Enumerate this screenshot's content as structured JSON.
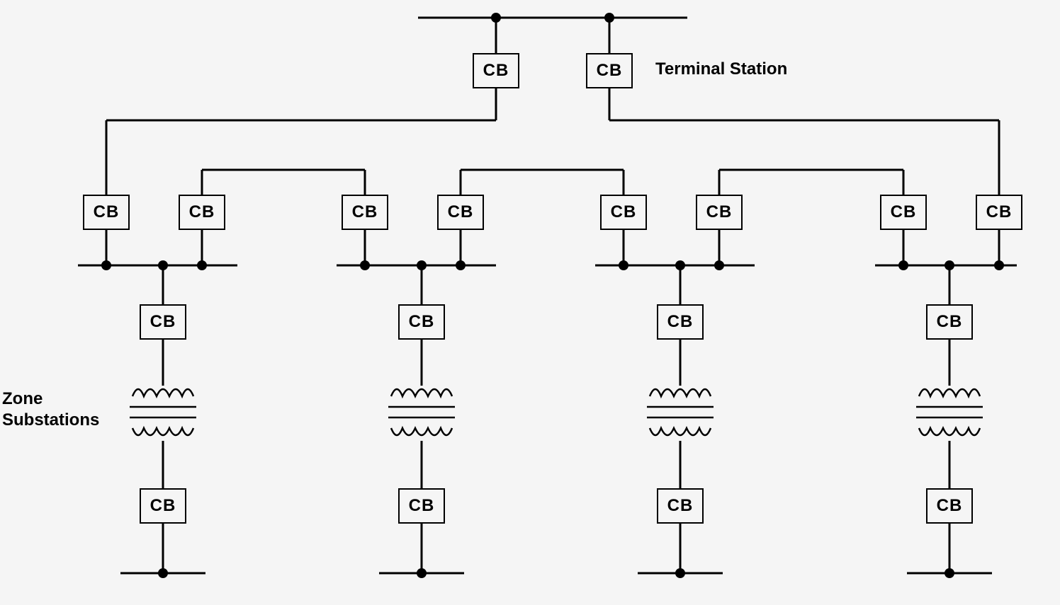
{
  "diagram": {
    "cb_label": "CB",
    "terminal_station_label": "Terminal Station",
    "zone_substations_label_line1": "Zone",
    "zone_substations_label_line2": "Substations",
    "stroke_color": "#000000",
    "stroke_width": 3,
    "node_radius": 7,
    "type": "electrical-single-line-diagram",
    "components": {
      "terminal_station": {
        "top_bus": true,
        "breakers": 2
      },
      "zone_substations": [
        {
          "id": 1,
          "incoming_breakers": 2,
          "transformer": true,
          "outgoing_breakers": 2
        },
        {
          "id": 2,
          "incoming_breakers": 2,
          "transformer": true,
          "outgoing_breakers": 2
        },
        {
          "id": 3,
          "incoming_breakers": 2,
          "transformer": true,
          "outgoing_breakers": 2
        },
        {
          "id": 4,
          "incoming_breakers": 2,
          "transformer": true,
          "outgoing_breakers": 2
        }
      ],
      "tie_lines": [
        {
          "between": [
            1,
            2
          ]
        },
        {
          "between": [
            2,
            3
          ]
        },
        {
          "between": [
            3,
            4
          ]
        }
      ]
    }
  }
}
